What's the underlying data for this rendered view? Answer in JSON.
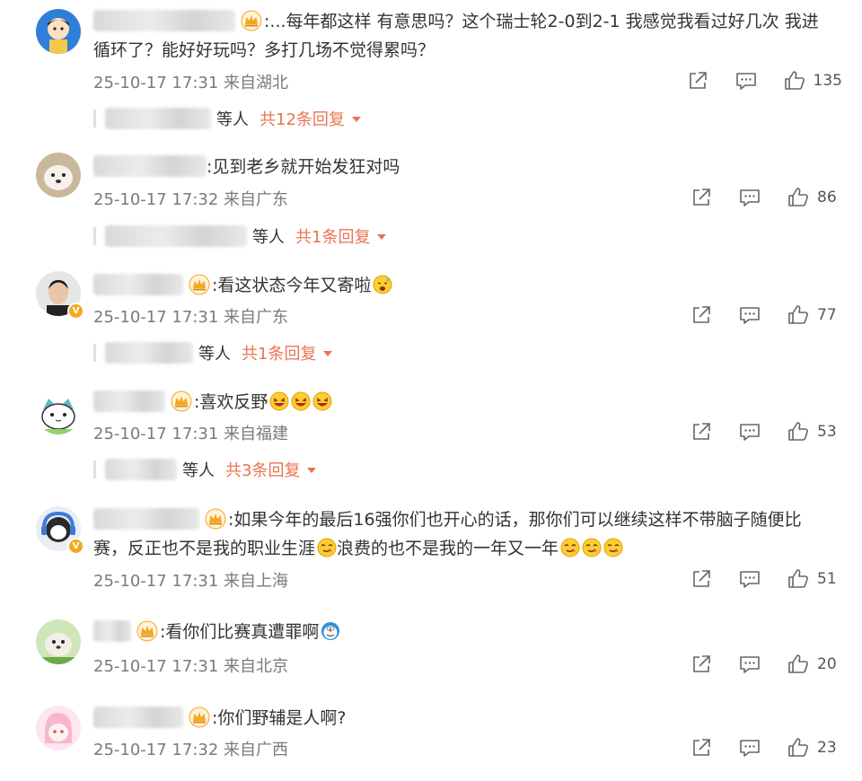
{
  "colors": {
    "accent": "#eb7350",
    "meta": "#7a7a7a",
    "text": "#333333",
    "vip": "#f5a623"
  },
  "icons": {
    "share": "share-icon",
    "comment": "comment-icon",
    "like": "like-icon",
    "crown": "crown-badge-icon"
  },
  "comments": [
    {
      "text": ":...每年都这样 有意思吗？这个瑞士轮2-0到2-1 我感觉我看过好几次 我进循环了？能好好玩吗？多打几场不觉得累吗？",
      "text_line1": ":...每年都这样 有意思吗？这个瑞士轮2-0到2-1 我感觉我看过好几次 我进",
      "text_line2": "循环了？能好好玩吗？多打几场不觉得累吗？",
      "time": "25-10-17 17:31",
      "location": "来自湖北",
      "likes": "135",
      "replies": {
        "who": "等人",
        "count": "共12条回复"
      }
    },
    {
      "text": ":见到老乡就开始发狂对吗",
      "time": "25-10-17 17:32",
      "location": "来自广东",
      "likes": "86",
      "replies": {
        "who": "等人",
        "count": "共1条回复"
      }
    },
    {
      "text": ":看这状态今年又寄啦",
      "time": "25-10-17 17:31",
      "location": "来自广东",
      "likes": "77",
      "replies": {
        "who": "等人",
        "count": "共1条回复"
      }
    },
    {
      "text": ":喜欢反野",
      "time": "25-10-17 17:31",
      "location": "来自福建",
      "likes": "53",
      "replies": {
        "who": "等人",
        "count": "共3条回复"
      }
    },
    {
      "text_line1": ":如果今年的最后16强你们也开心的话，那你们可以继续这样不带脑子随便比",
      "text_line2a": "赛，反正也不是我的职业生涯",
      "text_line2b": "浪费的也不是我的一年又一年",
      "time": "25-10-17 17:31",
      "location": "来自上海",
      "likes": "51"
    },
    {
      "text": ":看你们比赛真遭罪啊",
      "time": "25-10-17 17:31",
      "location": "来自北京",
      "likes": "20"
    },
    {
      "text": ":你们野辅是人啊?",
      "time": "25-10-17 17:32",
      "location": "来自广西",
      "likes": "23"
    }
  ]
}
